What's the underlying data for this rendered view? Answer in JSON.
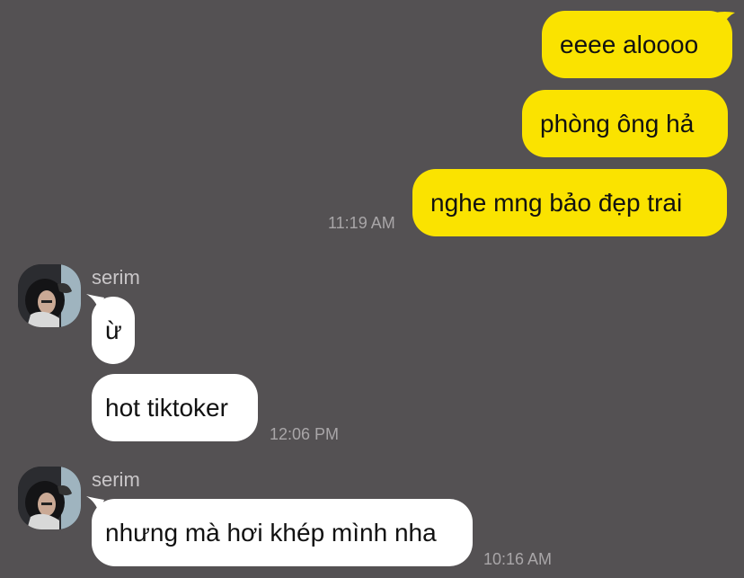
{
  "theme": {
    "background": "#545153",
    "outgoing_bubble": "#FAE300",
    "incoming_bubble": "#FFFFFF",
    "timestamp_color": "#A9A6A8"
  },
  "conversation": {
    "outgoing_group": {
      "messages": [
        "eeee aloooo",
        "phòng ông hả",
        "nghe mng bảo đẹp trai"
      ],
      "time": "11:19 AM"
    },
    "incoming_group_1": {
      "sender": "serim",
      "avatar_icon": "user-photo-avatar",
      "messages": [
        "ừ",
        "hot tiktoker"
      ],
      "time": "12:06 PM"
    },
    "incoming_group_2": {
      "sender": "serim",
      "avatar_icon": "user-photo-avatar",
      "messages": [
        "nhưng mà hơi khép mình nha"
      ],
      "time": "10:16 AM"
    }
  }
}
